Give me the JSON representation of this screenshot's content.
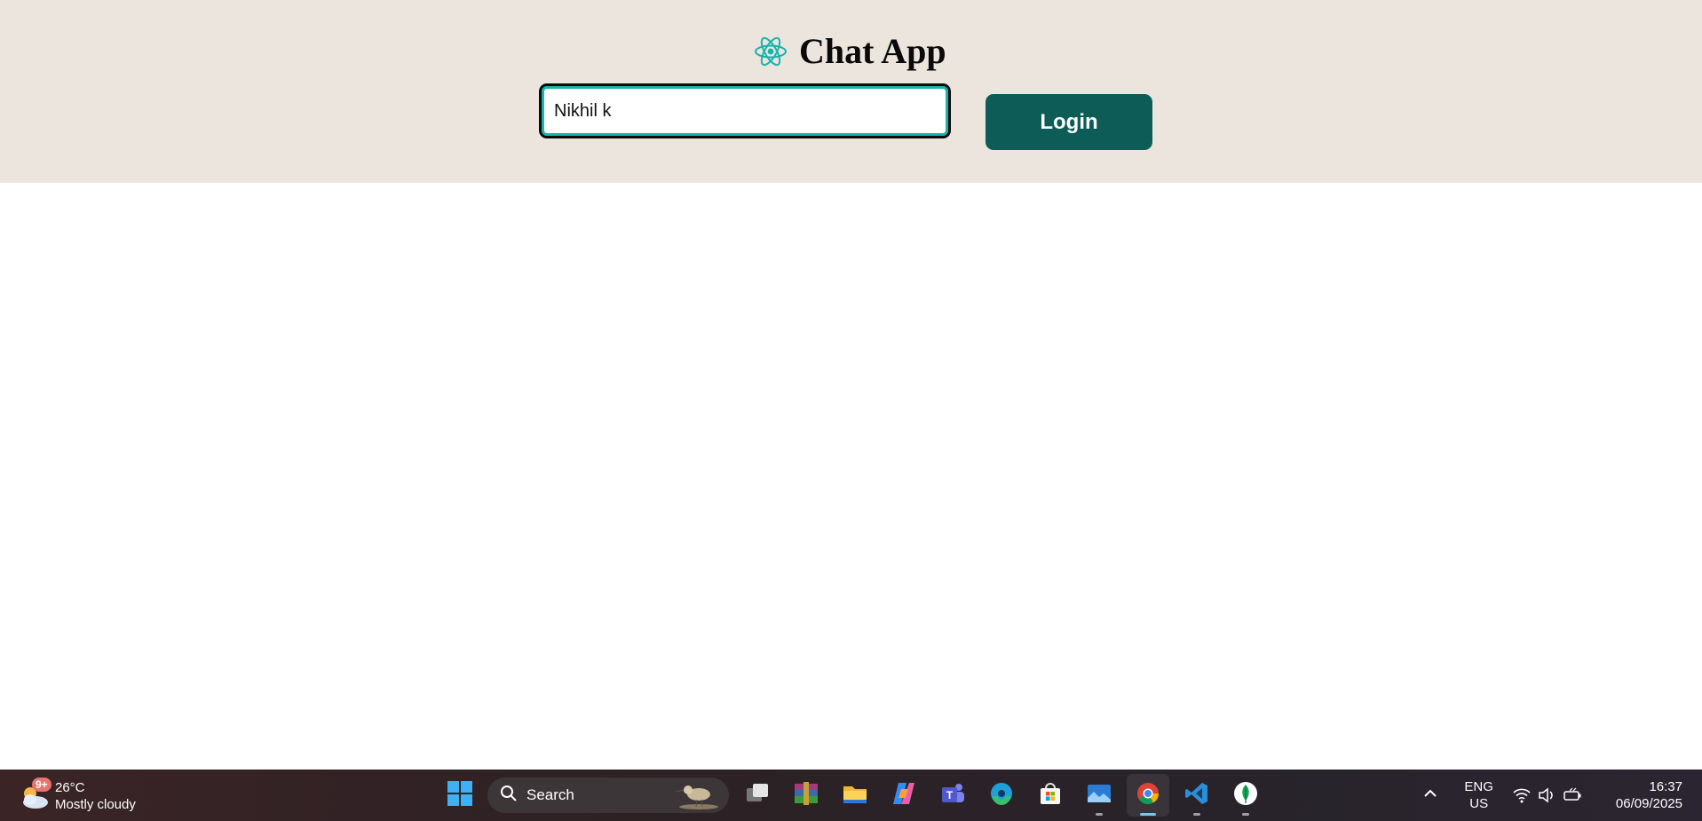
{
  "app": {
    "title": "Chat App",
    "icon": "react-atom-icon",
    "accent_color": "#17b3ad"
  },
  "login_form": {
    "name_value": "Nikhil k",
    "login_label": "Login",
    "button_color": "#0d5c57"
  },
  "taskbar": {
    "weather": {
      "badge": "9+",
      "temperature": "26°C",
      "condition": "Mostly cloudy",
      "icon": "cloud-sun-icon"
    },
    "search": {
      "label": "Search"
    },
    "apps": [
      {
        "name": "start-button",
        "icon": "windows-logo-icon"
      },
      {
        "name": "task-view",
        "icon": "task-view-icon"
      },
      {
        "name": "winrar",
        "icon": "winrar-icon"
      },
      {
        "name": "file-explorer",
        "icon": "folder-icon"
      },
      {
        "name": "copilot",
        "icon": "copilot-icon"
      },
      {
        "name": "teams",
        "icon": "teams-icon"
      },
      {
        "name": "edge",
        "icon": "edge-icon"
      },
      {
        "name": "microsoft-store",
        "icon": "store-icon"
      },
      {
        "name": "photos",
        "icon": "photos-icon"
      },
      {
        "name": "chrome",
        "icon": "chrome-icon"
      },
      {
        "name": "vscode",
        "icon": "vscode-icon"
      },
      {
        "name": "mongodb-compass",
        "icon": "mongodb-leaf-icon"
      }
    ],
    "tray": {
      "lang_top": "ENG",
      "lang_bottom": "US",
      "time": "16:37",
      "date": "06/09/2025"
    }
  }
}
